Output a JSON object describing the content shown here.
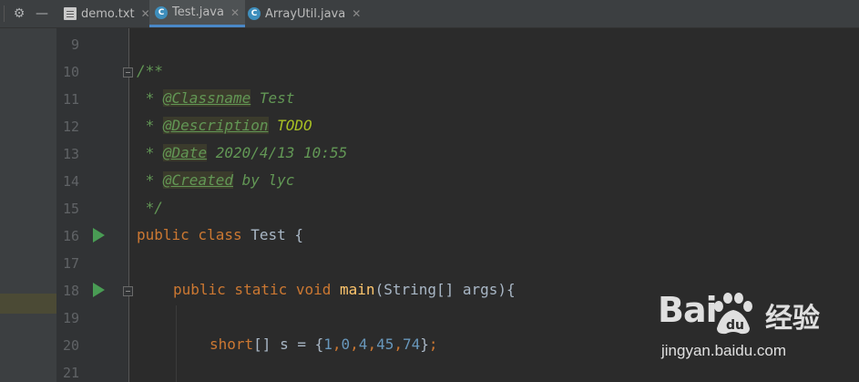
{
  "toolbar": {
    "settings_icon": "gear-icon",
    "hide_icon": "minus-icon"
  },
  "tabs": [
    {
      "label": "demo.txt",
      "icon": "text-file-icon",
      "active": false
    },
    {
      "label": "Test.java",
      "icon": "java-class-icon",
      "active": true
    },
    {
      "label": "ArrayUtil.java",
      "icon": "java-class-icon",
      "active": false
    }
  ],
  "line_numbers": [
    "9",
    "10",
    "11",
    "12",
    "13",
    "14",
    "15",
    "16",
    "17",
    "18",
    "19",
    "20",
    "21"
  ],
  "code": {
    "l10": "/**",
    "l11_prefix": " * ",
    "l11_tag": "@Classname",
    "l11_val": " Test",
    "l12_prefix": " * ",
    "l12_tag": "@Description",
    "l12_val": " TODO",
    "l13_prefix": " * ",
    "l13_tag": "@Date",
    "l13_val": " 2020/4/13 10:55",
    "l14_prefix": " * ",
    "l14_tag": "@Created",
    "l14_val": " by lyc",
    "l15": " */",
    "l16_kw": "public class",
    "l16_rest": " Test {",
    "l18_kw": "public static void",
    "l18_fn": "main",
    "l18_rest": "(String[] args){",
    "l20_kw": "short",
    "l20_a": "[] s = {",
    "l20_n1": "1",
    "l20_n2": "0",
    "l20_n3": "4",
    "l20_n4": "45",
    "l20_n5": "74",
    "l20_b": "}",
    "l20_semi": ";",
    "comma": ","
  },
  "watermark": {
    "logo": "Bai",
    "logo2": "du",
    "text": "经验",
    "url": "jingyan.baidu.com"
  },
  "colors": {
    "keyword": "#cc7832",
    "doc": "#629755",
    "number": "#6897bb",
    "function": "#ffc66d",
    "run": "#499c54"
  }
}
